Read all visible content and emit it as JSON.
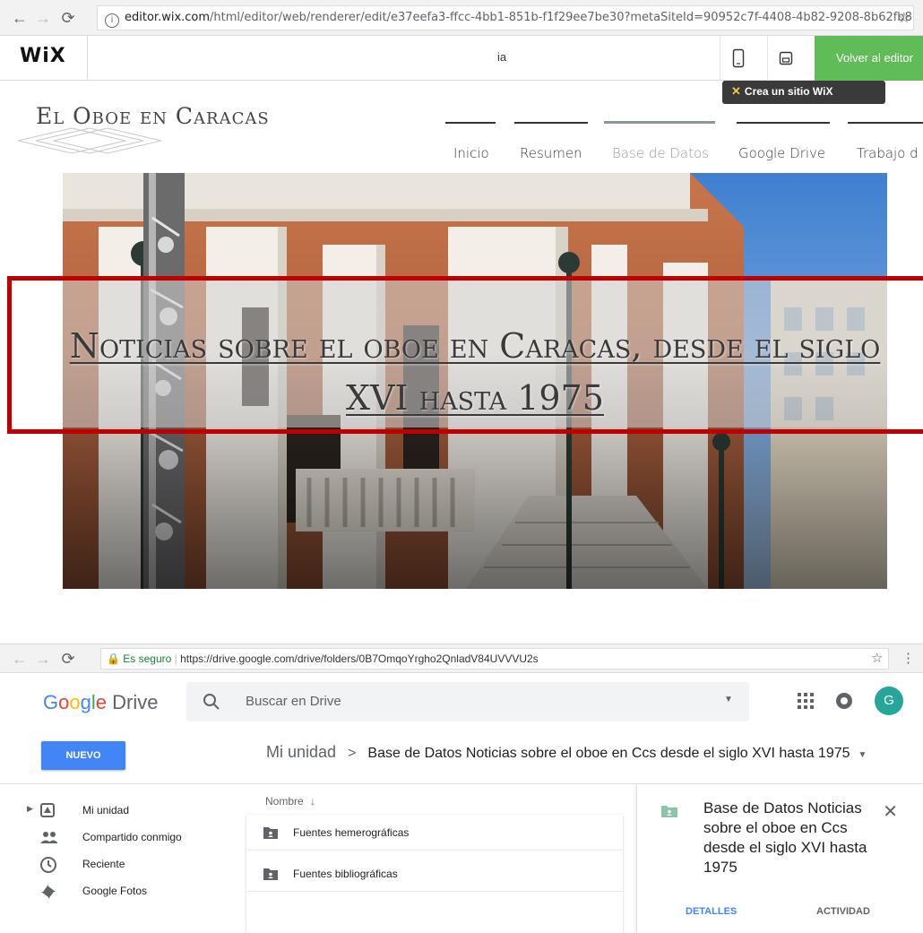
{
  "wix_browser": {
    "url_host": "editor.wix.com",
    "url_path": "/html/editor/web/renderer/edit/e37eefa3-ffcc-4bb1-851b-f1f29ee7be30?metaSiteId=90952c7f-4408-4b82-9208-8b62fb8",
    "editor": {
      "logo": "WiX",
      "page_selector": "ia",
      "publish_label": "Volver al editor",
      "tooltip_label": "Crea un sitio WiX"
    },
    "site": {
      "title": "El Oboe en Caracas",
      "nav": [
        "Inicio",
        "Resumen",
        "Base de Datos",
        "Google Drive",
        "Trabajo d"
      ],
      "active_nav": "Base de Datos",
      "hero_heading": "Noticias sobre el oboe en Caracas, desde el siglo XVI hasta 1975"
    },
    "highlight_color": "#c00000"
  },
  "drive_browser": {
    "secure_label": "Es seguro",
    "url": "https://drive.google.com/drive/folders/0B7OmqoYrgho2QnladV84UVVVU2s",
    "header": {
      "logo_google": "Google",
      "logo_drive": "Drive",
      "search_placeholder": "Buscar en Drive",
      "avatar_letter": "G"
    },
    "toolbar": {
      "new_button": "NUEVO",
      "breadcrumb_root": "Mi unidad",
      "breadcrumb_sep": ">",
      "breadcrumb_current": "Base de Datos Noticias sobre el oboe en Ccs desde el siglo XVI hasta 1975"
    },
    "sidebar": [
      {
        "label": "Mi unidad",
        "icon": "drive-icon"
      },
      {
        "label": "Compartido conmigo",
        "icon": "people-icon"
      },
      {
        "label": "Reciente",
        "icon": "clock-icon"
      },
      {
        "label": "Google Fotos",
        "icon": "photos-icon"
      }
    ],
    "files": {
      "column_header": "Nombre",
      "rows": [
        "Fuentes hemerográficas",
        "Fuentes bibliográficas"
      ]
    },
    "details": {
      "title": "Base de Datos Noticias sobre el oboe en Ccs desde el siglo XVI hasta 1975",
      "tab_details": "DETALLES",
      "tab_activity": "ACTIVIDAD"
    },
    "colors": {
      "accent": "#4285f4",
      "avatar": "#26a69a",
      "wix_green": "#60bc57"
    }
  }
}
